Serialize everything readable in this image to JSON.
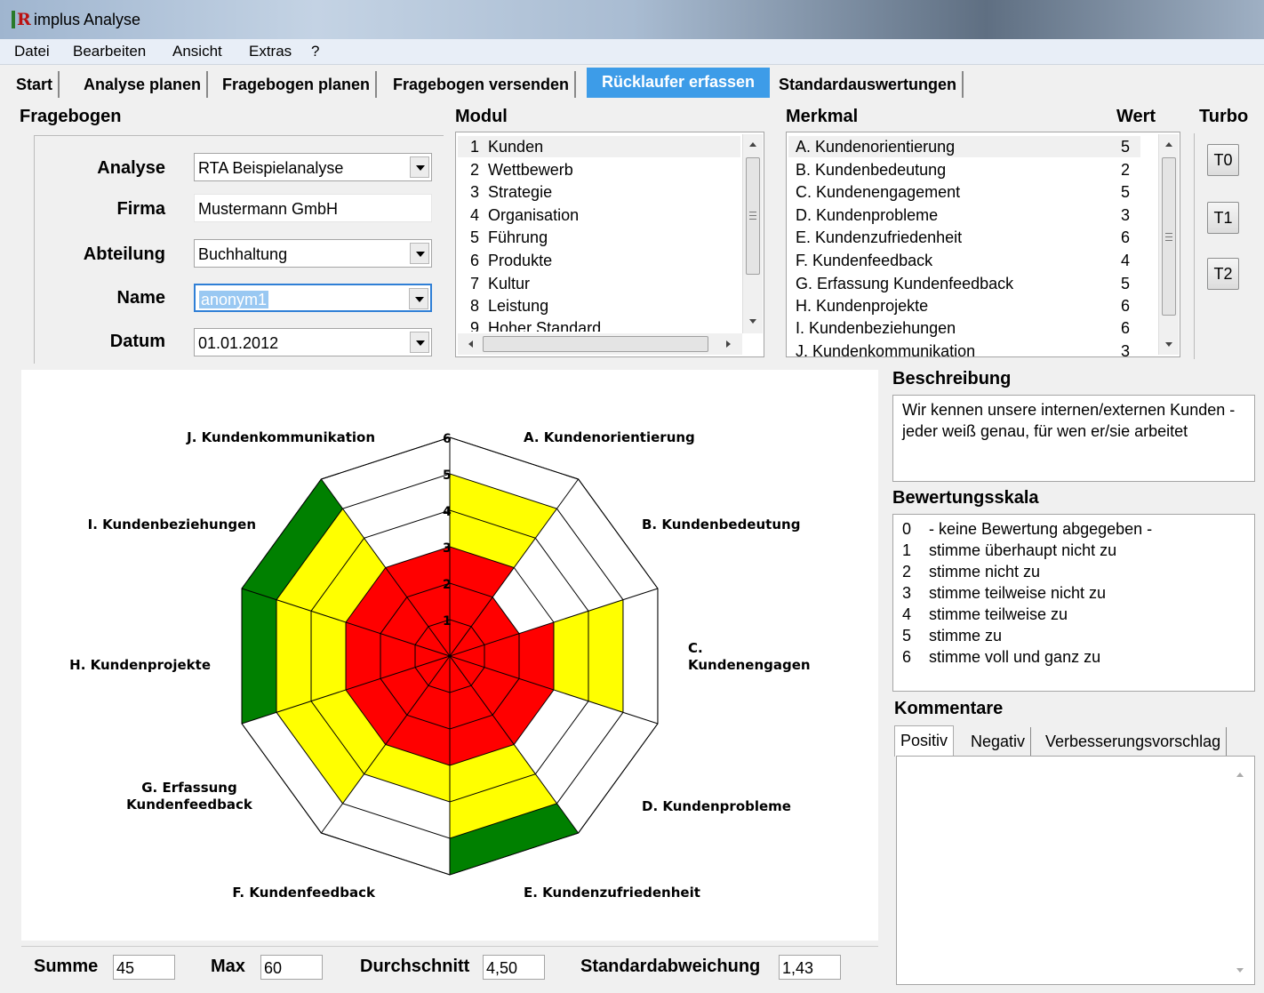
{
  "window": {
    "title": "implus Analyse",
    "logo": "R"
  },
  "menu": [
    "Datei",
    "Bearbeiten",
    "Ansicht",
    "Extras",
    "?"
  ],
  "tabs": [
    "Start",
    "Analyse planen",
    "Fragebogen planen",
    "Fragebogen versenden",
    "Rücklaufer erfassen",
    "Standardauswertungen"
  ],
  "active_tab": "Rücklaufer erfassen",
  "fragebogen": {
    "title": "Fragebogen",
    "analyse_label": "Analyse",
    "analyse_value": "RTA Beispielanalyse",
    "firma_label": "Firma",
    "firma_value": "Mustermann GmbH",
    "abteilung_label": "Abteilung",
    "abteilung_value": "Buchhaltung",
    "name_label": "Name",
    "name_value": "anonym1",
    "datum_label": "Datum",
    "datum_value": "01.01.2012"
  },
  "modul": {
    "title": "Modul",
    "items": [
      {
        "no": "1",
        "label": "Kunden"
      },
      {
        "no": "2",
        "label": "Wettbewerb"
      },
      {
        "no": "3",
        "label": "Strategie"
      },
      {
        "no": "4",
        "label": "Organisation"
      },
      {
        "no": "5",
        "label": "Führung"
      },
      {
        "no": "6",
        "label": "Produkte"
      },
      {
        "no": "7",
        "label": "Kultur"
      },
      {
        "no": "8",
        "label": "Leistung"
      },
      {
        "no": "9",
        "label": "Hoher Standard"
      }
    ]
  },
  "merkmal": {
    "title": "Merkmal",
    "wert_title": "Wert",
    "items": [
      {
        "label": "A. Kundenorientierung",
        "wert": "5"
      },
      {
        "label": "B. Kundenbedeutung",
        "wert": "2"
      },
      {
        "label": "C. Kundenengagement",
        "wert": "5"
      },
      {
        "label": "D. Kundenprobleme",
        "wert": "3"
      },
      {
        "label": "E. Kundenzufriedenheit",
        "wert": "6"
      },
      {
        "label": "F. Kundenfeedback",
        "wert": "4"
      },
      {
        "label": "G. Erfassung Kundenfeedback",
        "wert": "5"
      },
      {
        "label": "H. Kundenprojekte",
        "wert": "6"
      },
      {
        "label": "I. Kundenbeziehungen",
        "wert": "6"
      },
      {
        "label": "J. Kundenkommunikation",
        "wert": "3"
      }
    ]
  },
  "turbo": {
    "title": "Turbo",
    "buttons": [
      "T0",
      "T1",
      "T2"
    ]
  },
  "beschreibung": {
    "title": "Beschreibung",
    "text": "Wir kennen unsere internen/externen Kunden - jeder weiß genau, für wen er/sie arbeitet"
  },
  "bewertungsskala": {
    "title": "Bewertungsskala",
    "rows": [
      {
        "n": "0",
        "t": "- keine Bewertung abgegeben -"
      },
      {
        "n": "1",
        "t": "stimme überhaupt nicht zu"
      },
      {
        "n": "2",
        "t": "stimme nicht zu"
      },
      {
        "n": "3",
        "t": "stimme teilweise nicht zu"
      },
      {
        "n": "4",
        "t": "stimme teilweise zu"
      },
      {
        "n": "5",
        "t": "stimme zu"
      },
      {
        "n": "6",
        "t": "stimme voll und ganz zu"
      }
    ]
  },
  "kommentare": {
    "title": "Kommentare",
    "tabs": [
      "Positiv",
      "Negativ",
      "Verbesserungsvorschlag"
    ],
    "text": ""
  },
  "stats": {
    "summe_label": "Summe",
    "summe": "45",
    "max_label": "Max",
    "max": "60",
    "durchschnitt_label": "Durchschnitt",
    "durchschnitt": "4,50",
    "std_label": "Standardabweichung",
    "std": "1,43"
  },
  "chart_data": {
    "type": "radar",
    "categories": [
      "A. Kundenorientierung",
      "B. Kundenbedeutung",
      "C. Kundenengagement",
      "D. Kundenprobleme",
      "E. Kundenzufriedenheit",
      "F. Kundenfeedback",
      "G. Erfassung Kundenfeedback",
      "H. Kundenprojekte",
      "I. Kundenbeziehungen",
      "J. Kundenkommunikation"
    ],
    "axis_labels": [
      "A. Kundenorientierung",
      "B. Kundenbedeutung",
      "C. Kundenengagen",
      "D. Kundenprobleme",
      "E. Kundenzufriedenheit",
      "F. Kundenfeedback",
      "G. Erfassung|Kundenfeedback",
      "H. Kundenprojekte",
      "I. Kundenbeziehungen",
      "J. Kundenkommunikation"
    ],
    "values": [
      5,
      2,
      5,
      3,
      6,
      4,
      5,
      6,
      6,
      3
    ],
    "rmax": 6,
    "ticks": [
      "1",
      "2",
      "3",
      "4",
      "5",
      "6"
    ],
    "colors": {
      "low": "#ff0000",
      "mid": "#ffff00",
      "high": "#008000",
      "grid": "#000000",
      "bg": "#ffffff"
    }
  }
}
